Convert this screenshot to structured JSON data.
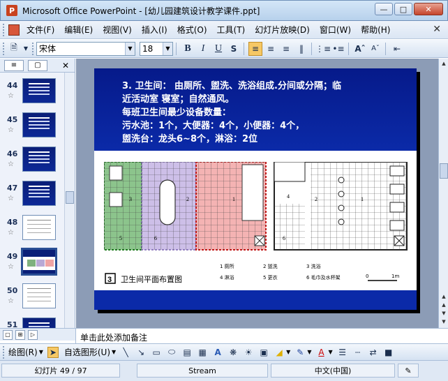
{
  "window": {
    "title": "Microsoft Office PowerPoint - [幼儿园建筑设计教学课件.ppt]"
  },
  "menu": [
    "文件(F)",
    "编辑(E)",
    "视图(V)",
    "插入(I)",
    "格式(O)",
    "工具(T)",
    "幻灯片放映(D)",
    "窗口(W)",
    "帮助(H)"
  ],
  "toolbar": {
    "font_name": "宋体",
    "font_size": "18"
  },
  "thumbnails": [
    {
      "num": "44",
      "kind": "dark"
    },
    {
      "num": "45",
      "kind": "dark"
    },
    {
      "num": "46",
      "kind": "dark"
    },
    {
      "num": "47",
      "kind": "dark"
    },
    {
      "num": "48",
      "kind": "white"
    },
    {
      "num": "49",
      "kind": "mixed",
      "selected": true
    },
    {
      "num": "50",
      "kind": "white"
    },
    {
      "num": "51",
      "kind": "dark"
    }
  ],
  "slide": {
    "lines": [
      "3. 卫生间： 由厕所、盥洗、洗浴组成.分间或分隔；临",
      "近活动室 寝室；自然通风。",
      "每班卫生间最少设备数量：",
      "污水池：1个，大便器：4个，小便器：4个，",
      "盥洗台：龙头6~8个，淋浴：2位"
    ],
    "figure": {
      "caption_num": "3",
      "caption": "卫生间平面布置图",
      "legend": [
        "1  厕所",
        "2  盥洗",
        "3  洗浴",
        "4  淋浴",
        "5  更衣",
        "6  毛巾及水杯架"
      ],
      "scale_0": "0",
      "scale_1": "1m",
      "labels": [
        "3",
        "5",
        "6",
        "2",
        "1",
        "4",
        "2",
        "1",
        "6"
      ]
    }
  },
  "notes": {
    "placeholder": "单击此处添加备注"
  },
  "drawbar": {
    "draw": "绘图(R)",
    "autoshapes": "自选图形(U)"
  },
  "status": {
    "slide": "幻灯片 49 / 97",
    "template": "Stream",
    "language": "中文(中国)"
  }
}
